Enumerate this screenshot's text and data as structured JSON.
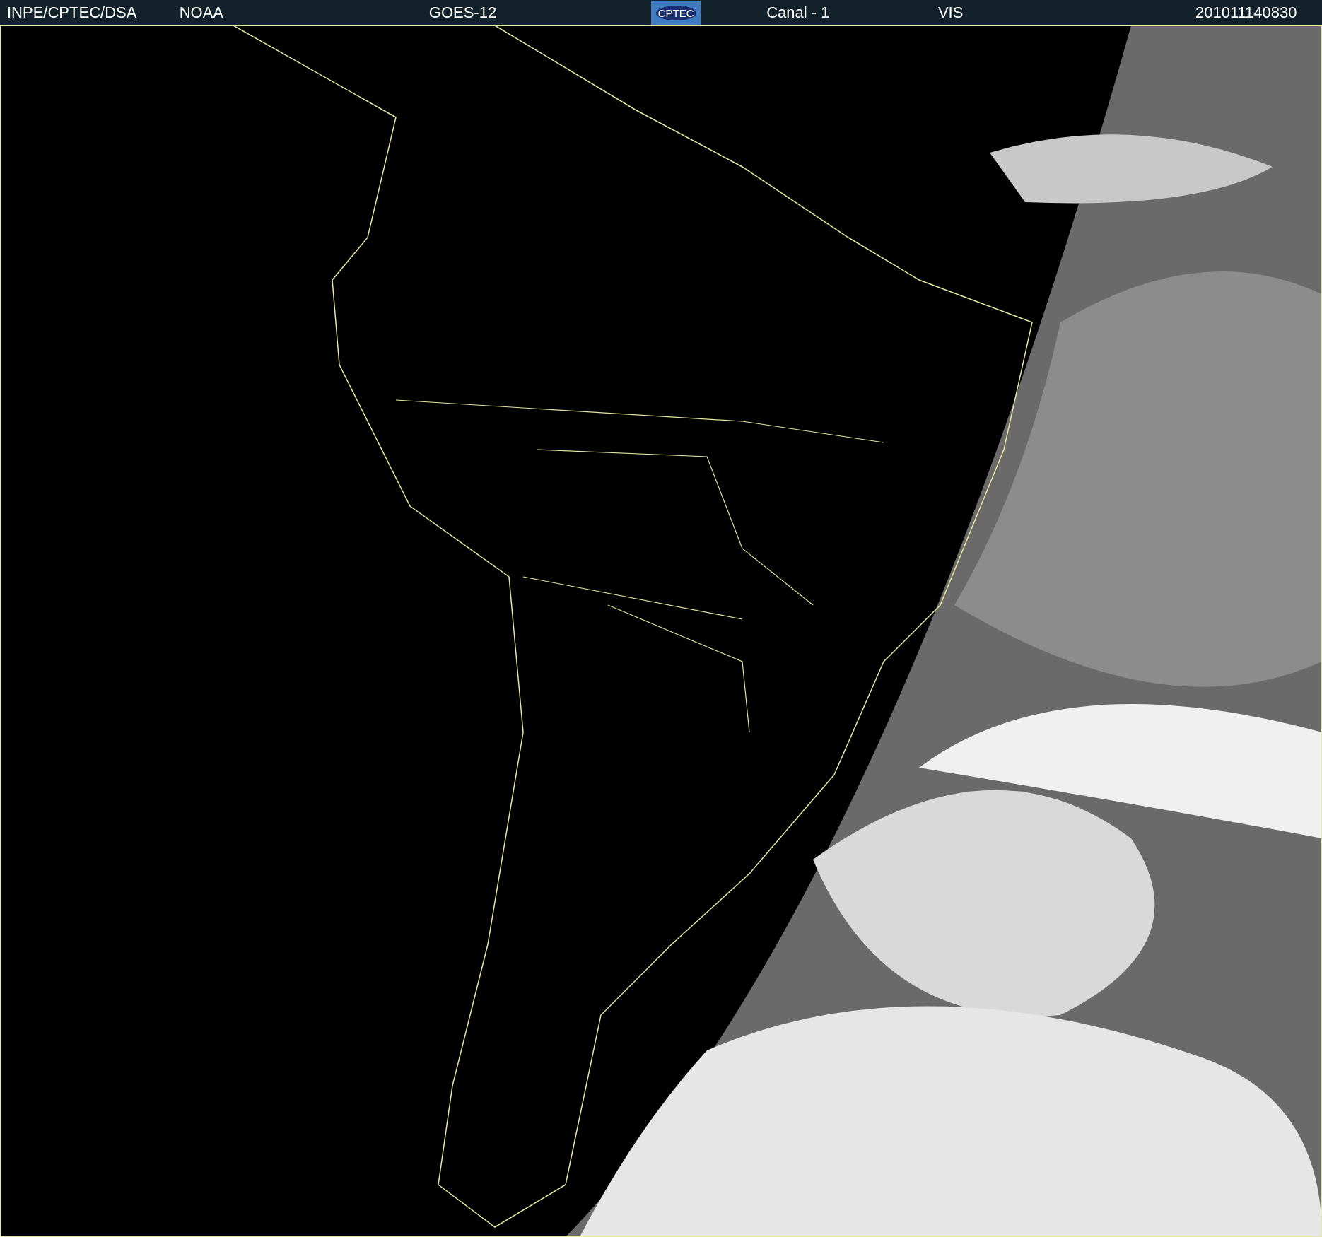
{
  "header": {
    "items": [
      {
        "kind": "text",
        "text": "INPE/CPTEC/DSA"
      },
      {
        "kind": "text",
        "text": "NOAA"
      },
      {
        "kind": "text",
        "text": "GOES-12"
      },
      {
        "kind": "logo",
        "text": "CPTEC"
      },
      {
        "kind": "text",
        "text": "Canal - 1"
      },
      {
        "kind": "text",
        "text": "VIS"
      },
      {
        "kind": "text",
        "text": "201011140830"
      }
    ]
  }
}
